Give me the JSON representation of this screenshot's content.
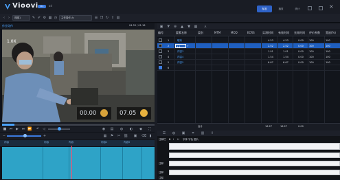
{
  "app": {
    "name": "Vioovi",
    "badge": "Pro",
    "subtitle": "ad"
  },
  "modes": [
    "标准",
    "播放",
    "统计"
  ],
  "toolbar": {
    "select_1": "视图1",
    "select_2": "主任操作 Ar"
  },
  "video": {
    "label": "作业动作",
    "counter": "04.53 / 01.18",
    "speed": "1.0X",
    "timer_1": "00.00",
    "timer_2": "07.05",
    "progress": 0.08
  },
  "timeline": {
    "ruler_labels": [
      "内容",
      "内容",
      "内容",
      "内容1",
      "内容5"
    ]
  },
  "table": {
    "headers": [
      "编号",
      "要素名称",
      "类别",
      "MTM",
      "MOD",
      "ECRS",
      "实测时间",
      "有效时间",
      "无效时间",
      "评价系数",
      "宽放(%)"
    ],
    "rows": [
      {
        "no": "1",
        "name": "取料",
        "type": "",
        "actual": "4.53",
        "valid": "4.53",
        "invalid": "0.00",
        "rating": "100",
        "allowance": "100",
        "selected": false
      },
      {
        "no": "2",
        "name": "1.1",
        "type": "✓",
        "actual": "2.52",
        "valid": "2.52",
        "invalid": "0.00",
        "rating": "100",
        "allowance": "100",
        "selected": true
      },
      {
        "no": "3",
        "name": "内容3",
        "type": "",
        "actual": "1.01",
        "valid": "1.01",
        "invalid": "0.00",
        "rating": "100",
        "allowance": "100",
        "selected": false
      },
      {
        "no": "4",
        "name": "内容4",
        "type": "",
        "actual": "1.54",
        "valid": "1.54",
        "invalid": "0.00",
        "rating": "100",
        "allowance": "100",
        "selected": false
      },
      {
        "no": "5",
        "name": "内容5",
        "type": "",
        "actual": "6.67",
        "valid": "6.67",
        "invalid": "0.00",
        "rating": "100",
        "allowance": "100",
        "selected": false
      },
      {
        "no": "6",
        "name": "",
        "type": "",
        "actual": "",
        "valid": "",
        "invalid": "",
        "rating": "",
        "allowance": "",
        "selected": false
      }
    ],
    "total": {
      "label": "合计",
      "actual": "16.27",
      "valid": "16.27",
      "invalid": "0.00"
    }
  },
  "bottom": {
    "label_1": "注释栏",
    "text_tools": "字体  字色  图片",
    "label_2": "注释",
    "label_3": "注释",
    "label_4": "注释"
  },
  "colors": {
    "accent": "#4aa3ff",
    "selected_row": "#1f5fbf",
    "track": "#2ea3c7"
  }
}
